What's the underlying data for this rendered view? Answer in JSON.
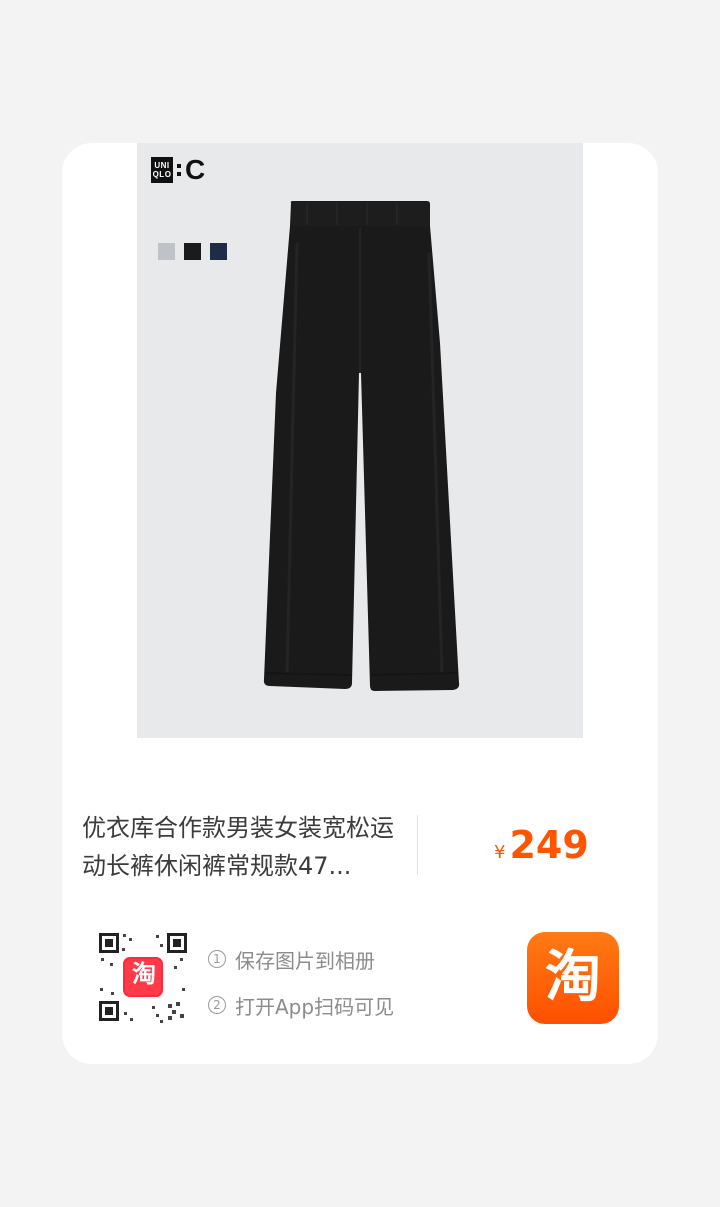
{
  "product": {
    "brand_logo_uq_line1": "UNI",
    "brand_logo_uq_line2": "QLO",
    "brand_logo_suffix": "C",
    "swatch_colors": [
      "#bfc2c6",
      "#1b1b1b",
      "#1f2b47"
    ],
    "title": "优衣库合作款男装女装宽松运动长裤休闲裤常规款47...",
    "price_currency": "¥",
    "price_value": "249"
  },
  "share": {
    "step1_num": "1",
    "step1_text": "保存图片到相册",
    "step2_num": "2",
    "step2_text": "打开App扫码可见"
  },
  "qr_badge_text": "淘",
  "app_icon": {
    "glyph": "淘",
    "color": "#ff5000"
  }
}
